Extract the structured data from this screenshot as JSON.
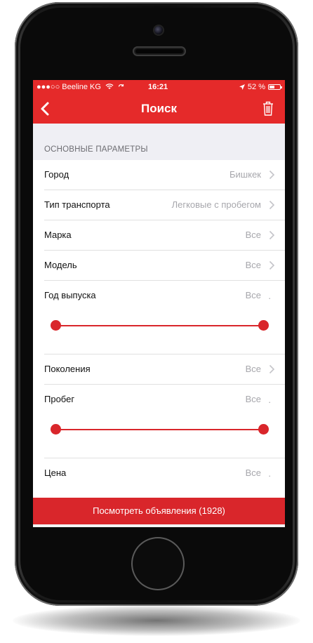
{
  "status_bar": {
    "carrier": "●●●○○ Beeline KG",
    "time": "16:21",
    "battery": "52 %",
    "battery_level": 0.52
  },
  "nav": {
    "title": "Поиск",
    "back_icon": "chevron-left-icon",
    "trash_icon": "trash-icon"
  },
  "section": {
    "title": "ОСНОВНЫЕ ПАРАМЕТРЫ"
  },
  "rows": {
    "city": {
      "label": "Город",
      "value": "Бишкек"
    },
    "transport": {
      "label": "Тип транспорта",
      "value": "Легковые с пробегом"
    },
    "brand": {
      "label": "Марка",
      "value": "Все"
    },
    "model": {
      "label": "Модель",
      "value": "Все"
    },
    "year": {
      "label": "Год выпуска",
      "value": "Все",
      "trail": "."
    },
    "generation": {
      "label": "Поколения",
      "value": "Все"
    },
    "mileage": {
      "label": "Пробег",
      "value": "Все",
      "trail": "."
    },
    "price": {
      "label": "Цена",
      "value": "Все",
      "trail": "."
    }
  },
  "cta": {
    "label": "Посмотреть объявления (1928)"
  },
  "colors": {
    "brand_red": "#e52a2a",
    "accent_red": "#d9262b"
  }
}
